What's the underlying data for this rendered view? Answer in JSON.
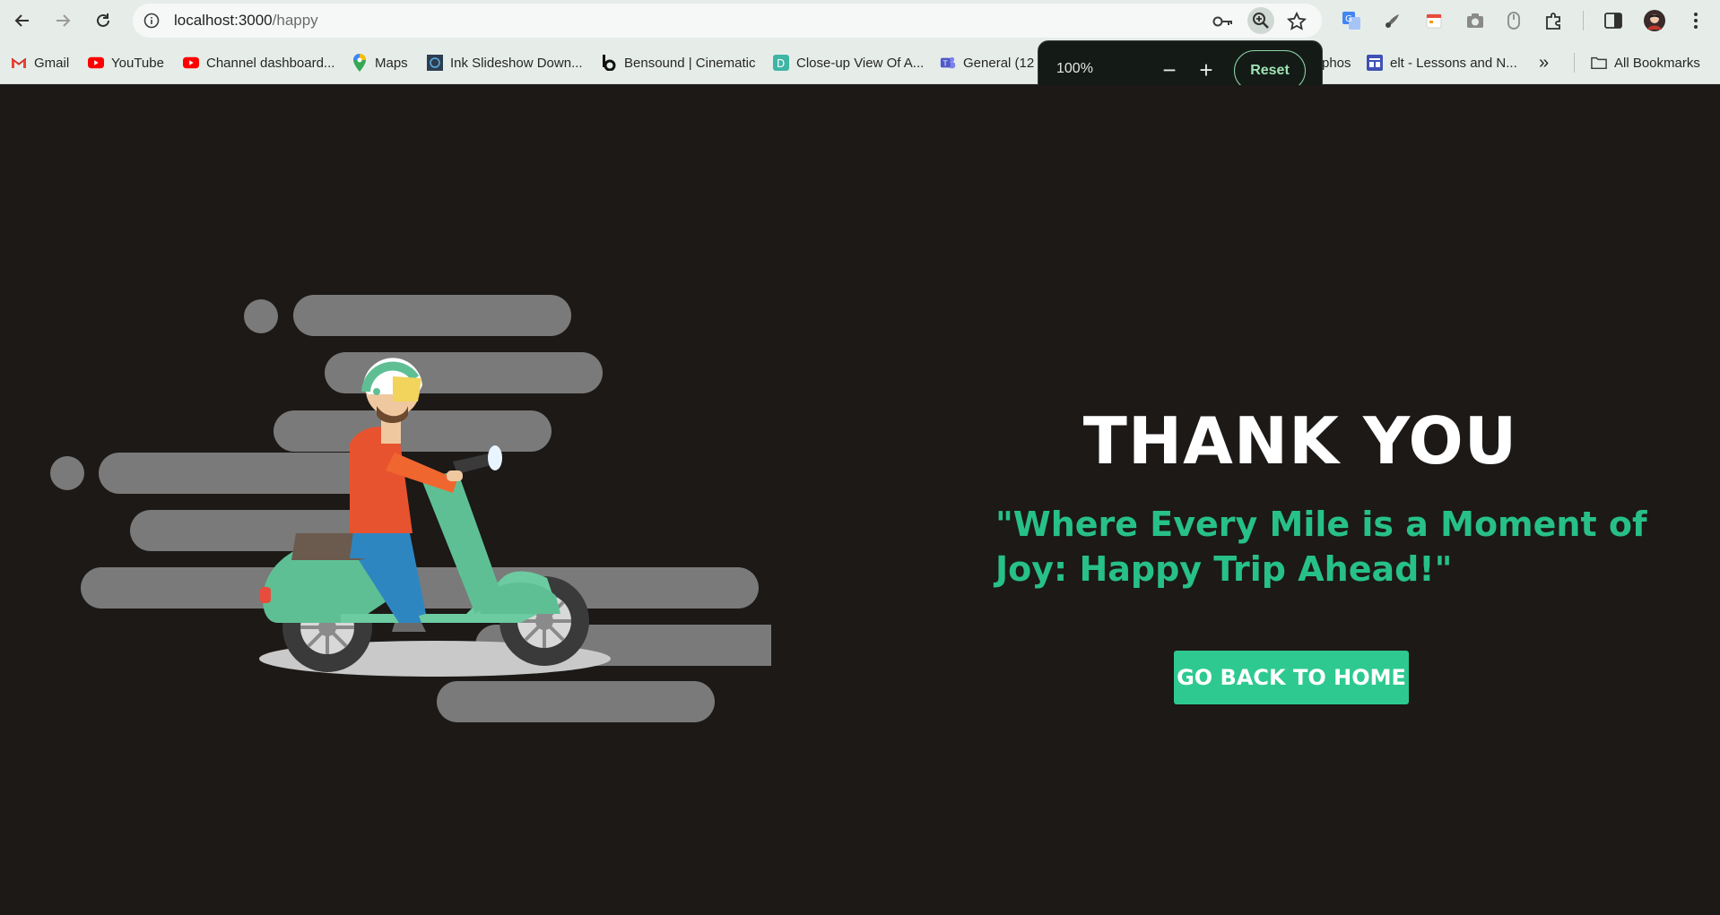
{
  "browser": {
    "url_host": "localhost:3000",
    "url_path": "/happy",
    "zoom": {
      "percent": "100%",
      "minus": "−",
      "plus": "+",
      "reset_label": "Reset"
    }
  },
  "bookmarks": {
    "items": [
      {
        "label": "Gmail",
        "icon": "gmail-icon",
        "color": "#ea4335"
      },
      {
        "label": "YouTube",
        "icon": "youtube-icon",
        "color": "#ff0000"
      },
      {
        "label": "Channel dashboard...",
        "icon": "youtube-icon",
        "color": "#ff0000"
      },
      {
        "label": "Maps",
        "icon": "maps-pin-icon",
        "color": "#34a853"
      },
      {
        "label": "Ink Slideshow Down...",
        "icon": "ink-icon",
        "color": "#2c3e50"
      },
      {
        "label": "Bensound | Cinematic",
        "icon": "bensound-icon",
        "color": "#111111"
      },
      {
        "label": "Close-up View Of A...",
        "icon": "d-icon",
        "color": "#3fb5a5"
      },
      {
        "label": "General (12",
        "icon": "teams-icon",
        "color": "#5059c9"
      },
      {
        "label": "phos",
        "icon": "",
        "color": ""
      },
      {
        "label": "elt - Lessons and N...",
        "icon": "elt-icon",
        "color": "#3f51b5"
      }
    ],
    "more": "»",
    "all_bookmarks": "All Bookmarks"
  },
  "main": {
    "title": "THANK YOU",
    "tagline": "\"Where Every Mile is a Moment of Joy: Happy Trip Ahead!\"",
    "button_label": "GO BACK TO HOME",
    "accent_color": "#2ec991",
    "background_color": "#1c1917"
  }
}
